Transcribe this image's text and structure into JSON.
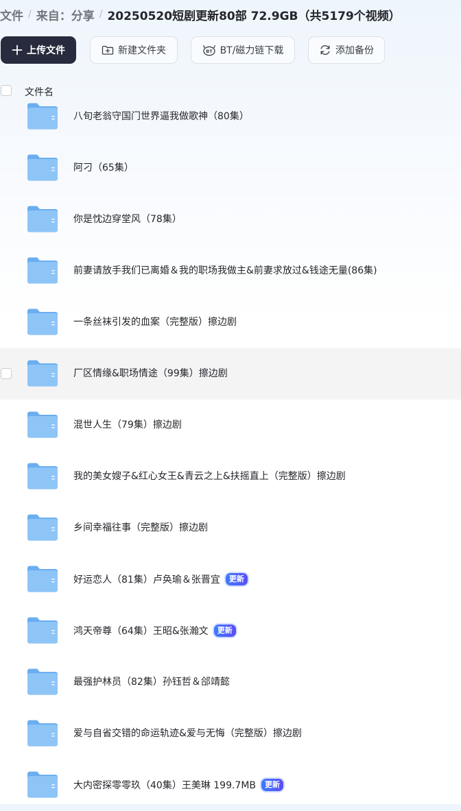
{
  "breadcrumb": {
    "items": [
      "文件",
      "来自：分享"
    ],
    "current": "20250520短剧更新80部 72.9GB（共5179个视频）"
  },
  "toolbar": {
    "upload": "上传文件",
    "new_folder": "新建文件夹",
    "bt": "BT/磁力链下载",
    "backup": "添加备份"
  },
  "list_header": {
    "name": "文件名"
  },
  "files": [
    {
      "name": "八旬老翁守国门世界逼我做歌神（80集）"
    },
    {
      "name": "阿刁（65集）"
    },
    {
      "name": "你是忱边穿堂风（78集）"
    },
    {
      "name": "前妻请放手我们已离婚＆我的职场我做主&前妻求放过&钱途无量(86集)"
    },
    {
      "name": "一条丝袜引发的血案（完整版）擦边剧"
    },
    {
      "name": "厂区情缘&职场情途（99集）擦边剧"
    },
    {
      "name": "混世人生（79集）擦边剧"
    },
    {
      "name": "我的美女嫂子&红心女王&青云之上&扶摇直上（完整版）擦边剧"
    },
    {
      "name": "乡间幸福往事（完整版）擦边剧"
    },
    {
      "name": "好运恋人（81集）卢奂瑜＆张晋宜",
      "badge": "更新"
    },
    {
      "name": "鸿天帝尊（64集）王昭&张瀚文",
      "badge": "更新"
    },
    {
      "name": "最强护林员（82集）孙钰哲＆郃靖懿"
    },
    {
      "name": "爱与自省交错的命运轨迹&爱与无悔（完整版）擦边剧"
    },
    {
      "name": "大内密探零零玖（40集）王美琳 199.7MB",
      "badge": "更新"
    }
  ]
}
